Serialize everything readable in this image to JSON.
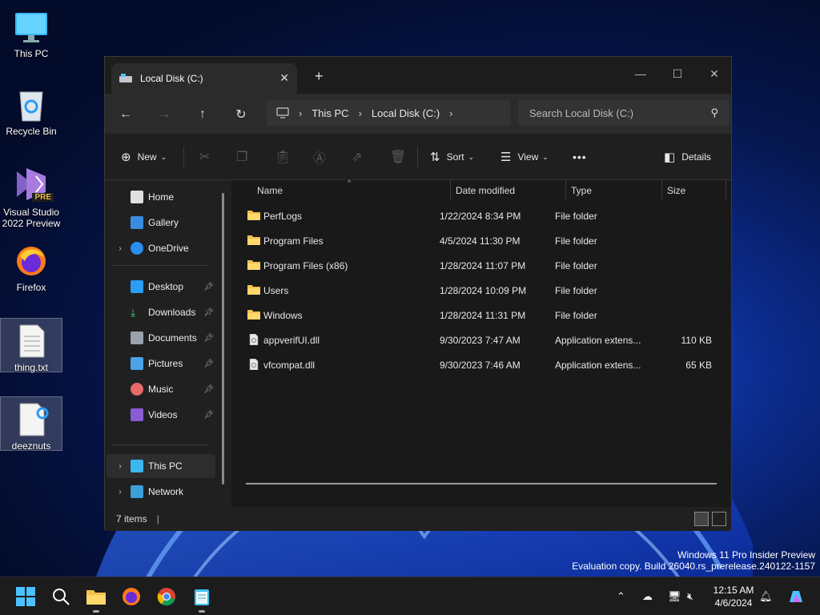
{
  "desktop": {
    "icons": [
      {
        "label": "This PC"
      },
      {
        "label": "Recycle Bin"
      },
      {
        "label": "Visual Studio 2022 Preview",
        "badge": "PRE"
      },
      {
        "label": "Firefox"
      },
      {
        "label": "thing.txt"
      },
      {
        "label": "deeznuts"
      }
    ]
  },
  "window": {
    "tab_title": "Local Disk (C:)",
    "new_tab": "+",
    "address": {
      "segments": [
        "This PC",
        "Local Disk (C:)"
      ]
    },
    "search_placeholder": "Search Local Disk (C:)",
    "toolbar": {
      "new_label": "New",
      "sort_label": "Sort",
      "view_label": "View",
      "more_label": "•••",
      "details_label": "Details"
    },
    "sidebar": {
      "top": [
        {
          "label": "Home"
        },
        {
          "label": "Gallery"
        },
        {
          "label": "OneDrive"
        }
      ],
      "quick": [
        {
          "label": "Desktop"
        },
        {
          "label": "Downloads"
        },
        {
          "label": "Documents"
        },
        {
          "label": "Pictures"
        },
        {
          "label": "Music"
        },
        {
          "label": "Videos"
        }
      ],
      "bottom": [
        {
          "label": "This PC"
        },
        {
          "label": "Network"
        }
      ]
    },
    "columns": {
      "name": "Name",
      "date": "Date modified",
      "type": "Type",
      "size": "Size"
    },
    "files": [
      {
        "name": "PerfLogs",
        "date": "1/22/2024 8:34 PM",
        "type": "File folder",
        "size": ""
      },
      {
        "name": "Program Files",
        "date": "4/5/2024 11:30 PM",
        "type": "File folder",
        "size": ""
      },
      {
        "name": "Program Files (x86)",
        "date": "1/28/2024 11:07 PM",
        "type": "File folder",
        "size": ""
      },
      {
        "name": "Users",
        "date": "1/28/2024 10:09 PM",
        "type": "File folder",
        "size": ""
      },
      {
        "name": "Windows",
        "date": "1/28/2024 11:31 PM",
        "type": "File folder",
        "size": ""
      },
      {
        "name": "appverifUI.dll",
        "date": "9/30/2023 7:47 AM",
        "type": "Application extens...",
        "size": "110 KB"
      },
      {
        "name": "vfcompat.dll",
        "date": "9/30/2023 7:46 AM",
        "type": "Application extens...",
        "size": "65 KB"
      }
    ],
    "status": "7 items"
  },
  "watermark": {
    "line1": "Windows 11 Pro Insider Preview",
    "line2": "Evaluation copy. Build 26040.rs_prerelease.240122-1157"
  },
  "clock": {
    "time": "12:15 AM",
    "date": "4/6/2024"
  },
  "colors": {
    "folder": "#f2c14e",
    "accent": "#4cc2ff"
  }
}
